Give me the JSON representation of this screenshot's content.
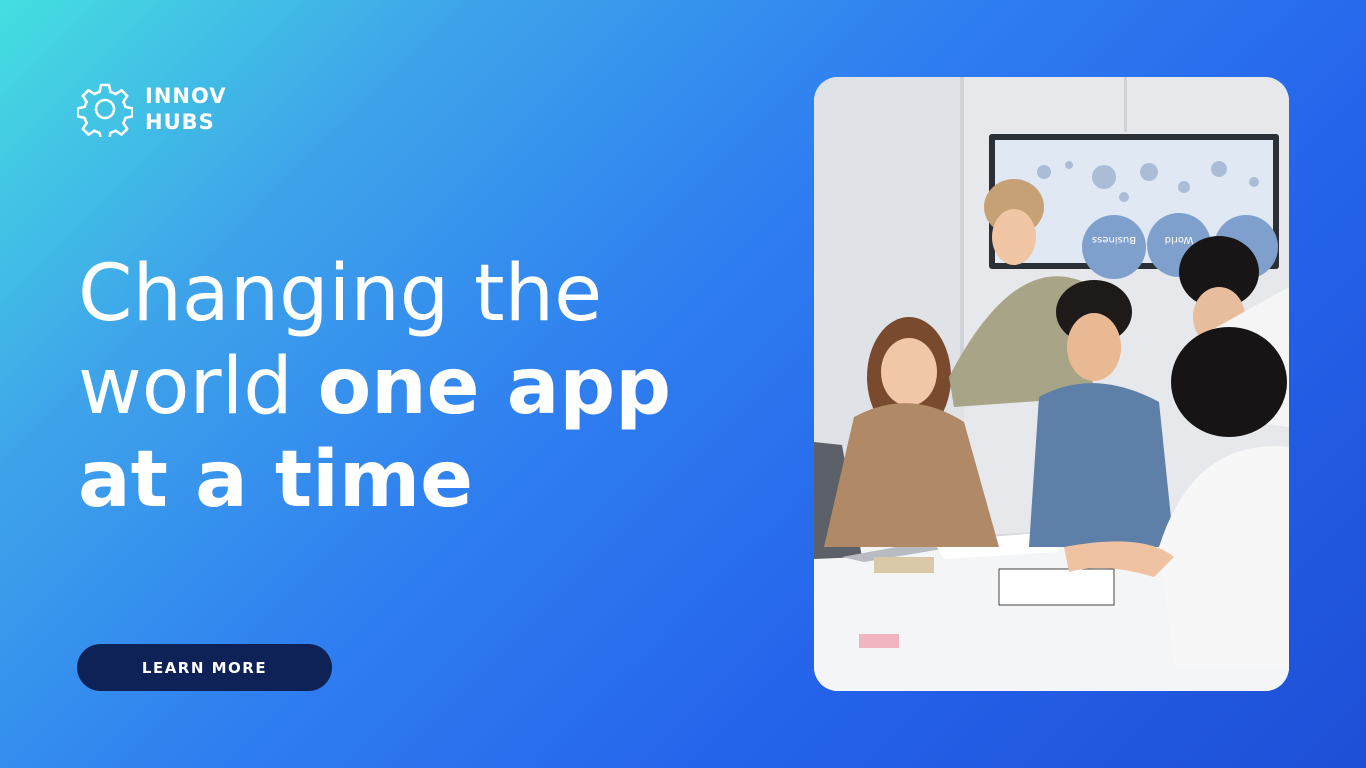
{
  "brand": {
    "name_line1": "INNOV",
    "name_line2": "HUBS",
    "icon": "gear-icon"
  },
  "hero": {
    "headline_light_1": "Changing the",
    "headline_light_2": "world ",
    "headline_bold_1": "one app",
    "headline_bold_2": "at a time"
  },
  "cta": {
    "label": "LEARN MORE"
  },
  "photo": {
    "screen_label_1": "Business",
    "screen_label_2": "World"
  },
  "colors": {
    "gradient_start": "#45dfe0",
    "gradient_end": "#1d4fd6",
    "button_bg": "#0f2257",
    "text": "#ffffff"
  }
}
